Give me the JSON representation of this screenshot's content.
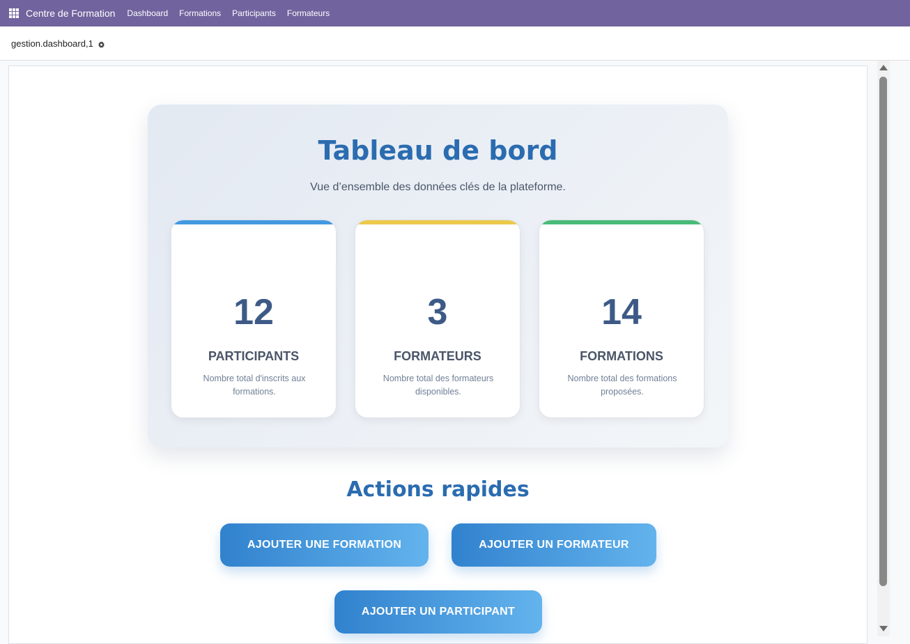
{
  "topbar": {
    "app_icon": "apps-grid-icon",
    "brand": "Centre de Formation",
    "nav": [
      "Dashboard",
      "Formations",
      "Participants",
      "Formateurs"
    ]
  },
  "breadcrumb": {
    "record": "gestion.dashboard,1",
    "icon": "gear-icon"
  },
  "dashboard": {
    "title": "Tableau de bord",
    "subtitle": "Vue d’ensemble des données clés de la plateforme.",
    "cards": [
      {
        "value": "12",
        "label": "PARTICIPANTS",
        "desc": "Nombre total d'inscrits aux formations.",
        "accent": "#4299e1"
      },
      {
        "value": "3",
        "label": "FORMATEURS",
        "desc": "Nombre total des formateurs disponibles.",
        "accent": "#ecc94b"
      },
      {
        "value": "14",
        "label": "FORMATIONS",
        "desc": "Nombre total des formations proposées.",
        "accent": "#48bb78"
      }
    ]
  },
  "actions": {
    "title": "Actions rapides",
    "add_formation": "AJOUTER UNE FORMATION",
    "add_formateur": "AJOUTER UN FORMATEUR",
    "add_participant": "AJOUTER UN PARTICIPANT"
  },
  "colors": {
    "topbar": "#71639e",
    "title_blue": "#2b6cb0"
  }
}
